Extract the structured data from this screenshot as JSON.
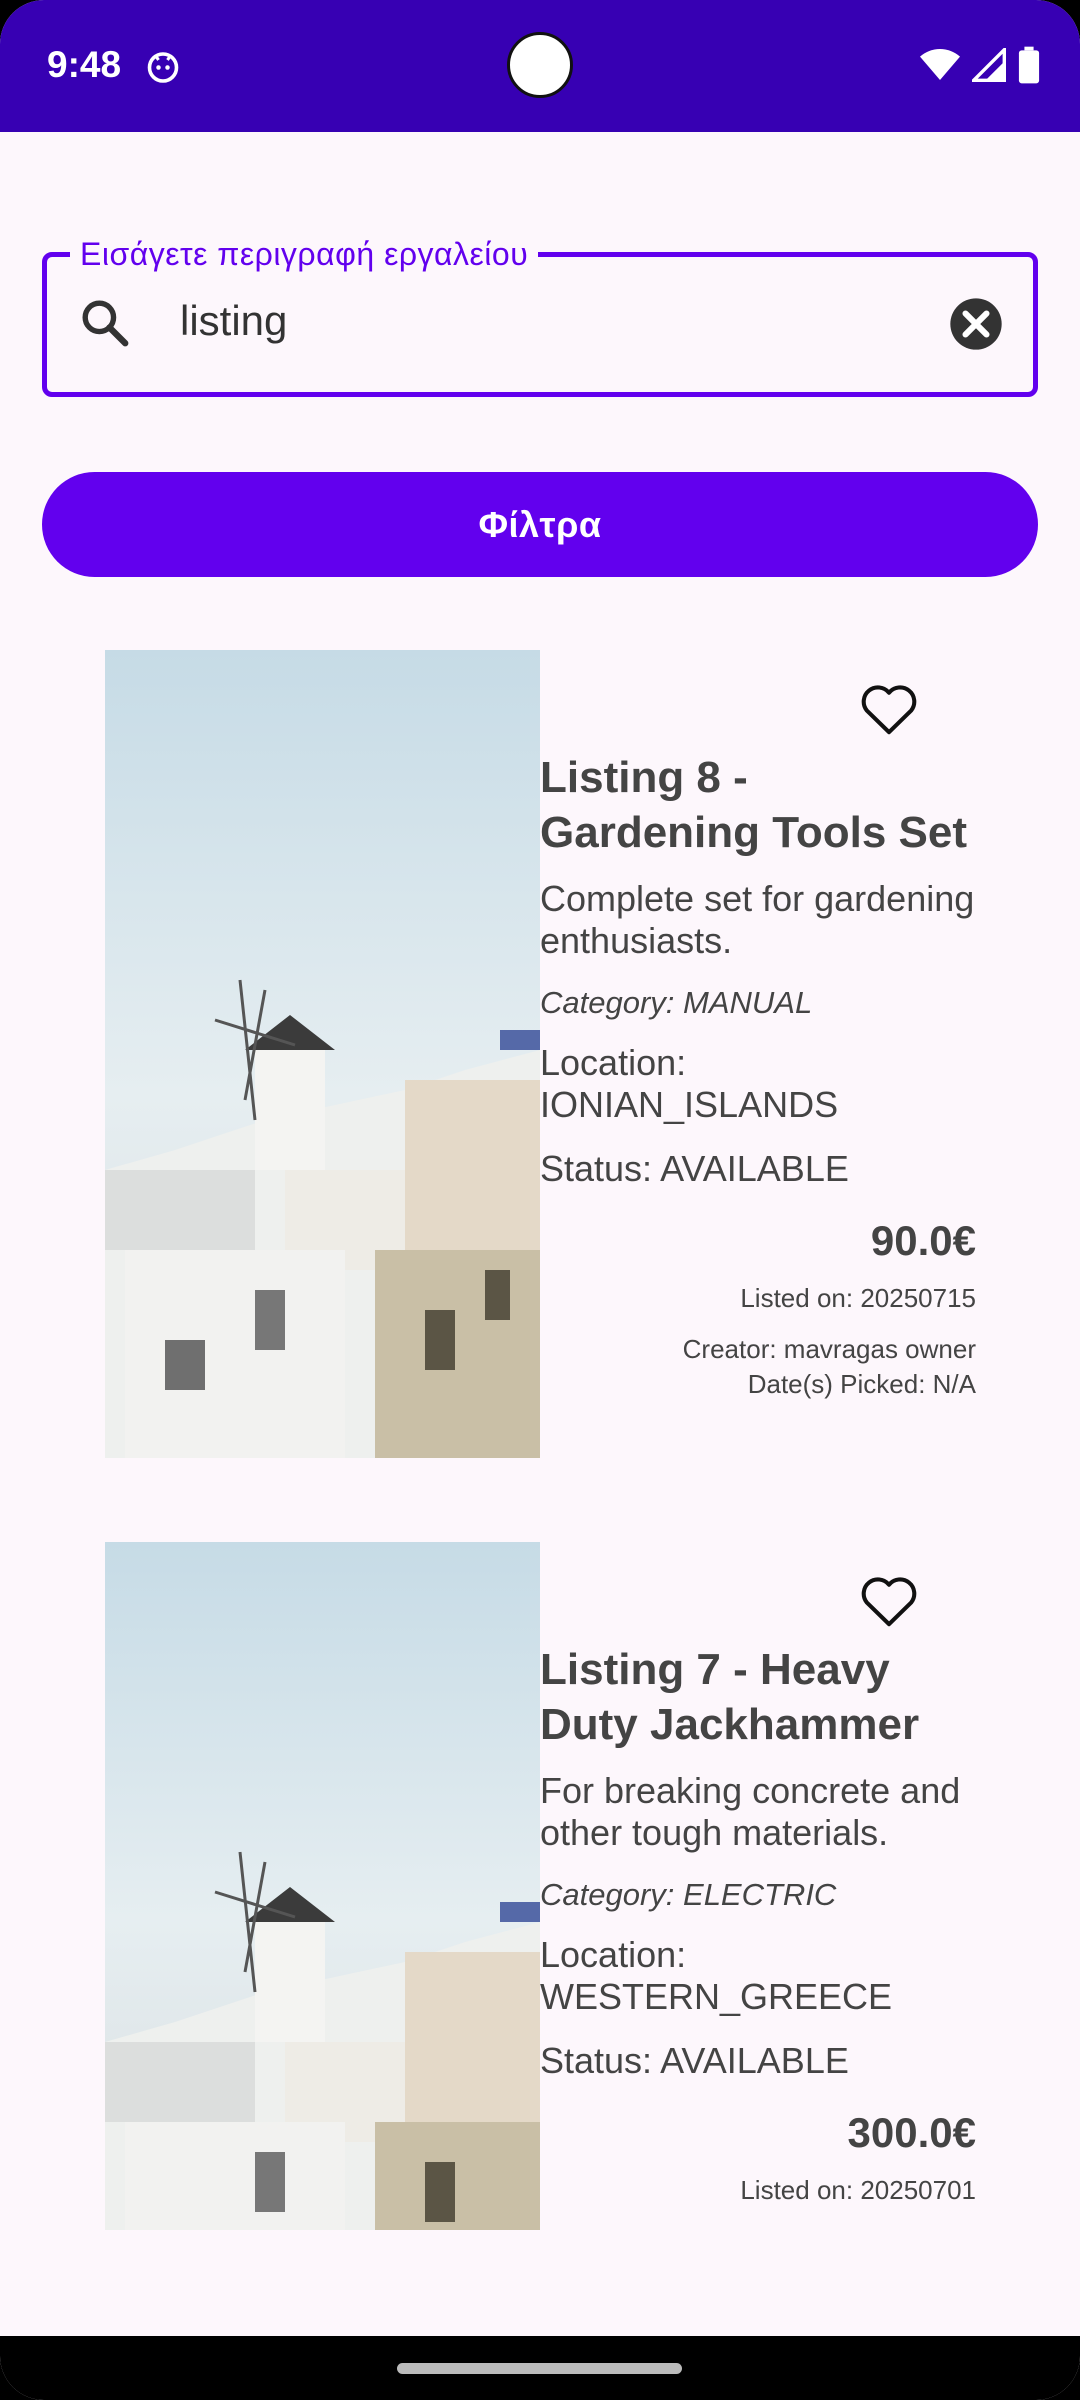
{
  "status_bar": {
    "time": "9:48",
    "app_icon": "android-debug-icon",
    "icons": [
      "wifi-icon",
      "signal-icon",
      "battery-icon"
    ]
  },
  "search": {
    "label": "Εισάγετε περιγραφή εργαλείου",
    "value": "listing",
    "search_icon": "search-icon",
    "clear_icon": "clear-icon"
  },
  "filter_button": {
    "label": "Φίλτρα"
  },
  "listings": [
    {
      "title": "Listing 8 - Gardening Tools Set",
      "description": "Complete set for gardening enthusiasts.",
      "category": "Category: MANUAL",
      "location": "Location: IONIAN_ISLANDS",
      "status": "Status: AVAILABLE",
      "price": "90.0€",
      "listed_on": "Listed on: 20250715",
      "creator": "Creator: mavragas owner",
      "dates_picked": "Date(s) Picked: N/A",
      "favorite_icon": "heart-outline-icon"
    },
    {
      "title": "Listing 7 - Heavy Duty Jackhammer",
      "description": "For breaking concrete and other tough materials.",
      "category": "Category: ELECTRIC",
      "location": "Location: WESTERN_GREECE",
      "status": "Status: AVAILABLE",
      "price": "300.0€",
      "listed_on": "Listed on: 20250701",
      "favorite_icon": "heart-outline-icon"
    }
  ],
  "colors": {
    "primary": "#6200ee",
    "status_bar": "#3700b3",
    "background": "#fdf7fc",
    "text": "#444444"
  }
}
